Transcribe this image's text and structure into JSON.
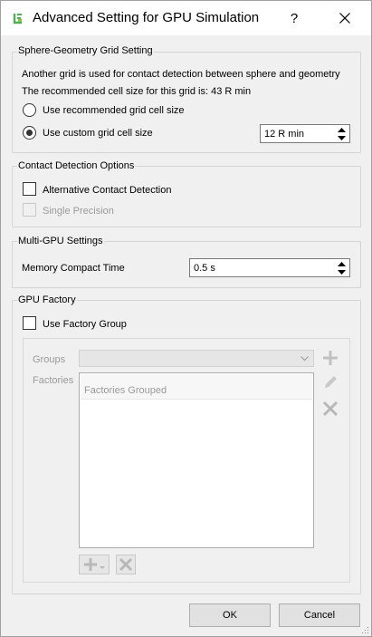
{
  "window": {
    "title": "Advanced Setting for GPU Simulation",
    "help_label": "?"
  },
  "sphere_geometry": {
    "title": "Sphere-Geometry Grid Setting",
    "description": "Another grid is used for contact detection between sphere and geometry",
    "recommended_text": "The recommended cell size for this grid is: 43 R min",
    "option_recommended": "Use recommended grid cell size",
    "option_custom": "Use custom grid cell size",
    "custom_value": "12 R min",
    "selected_option": "custom"
  },
  "contact_detection": {
    "title": "Contact Detection Options",
    "alternative_label": "Alternative Contact Detection",
    "alternative_checked": false,
    "single_precision_label": "Single Precision",
    "single_precision_enabled": false
  },
  "multi_gpu": {
    "title": "Multi-GPU Settings",
    "memory_compact_label": "Memory Compact Time",
    "memory_compact_value": "0.5 s"
  },
  "gpu_factory": {
    "title": "GPU Factory",
    "use_factory_group_label": "Use Factory Group",
    "use_factory_group_checked": false,
    "groups_label": "Groups",
    "factories_label": "Factories",
    "factories_list_header": "Factories Grouped",
    "icons": {
      "add_group": "plus-icon",
      "edit_group": "pencil-icon",
      "delete_group": "x-icon",
      "add_factory": "plus-dropdown-icon",
      "delete_factory": "x-icon"
    }
  },
  "buttons": {
    "ok": "OK",
    "cancel": "Cancel"
  },
  "colors": {
    "app_icon": "#4caf50",
    "disabled": "#9a9a9a",
    "background": "#f0f0f0"
  }
}
